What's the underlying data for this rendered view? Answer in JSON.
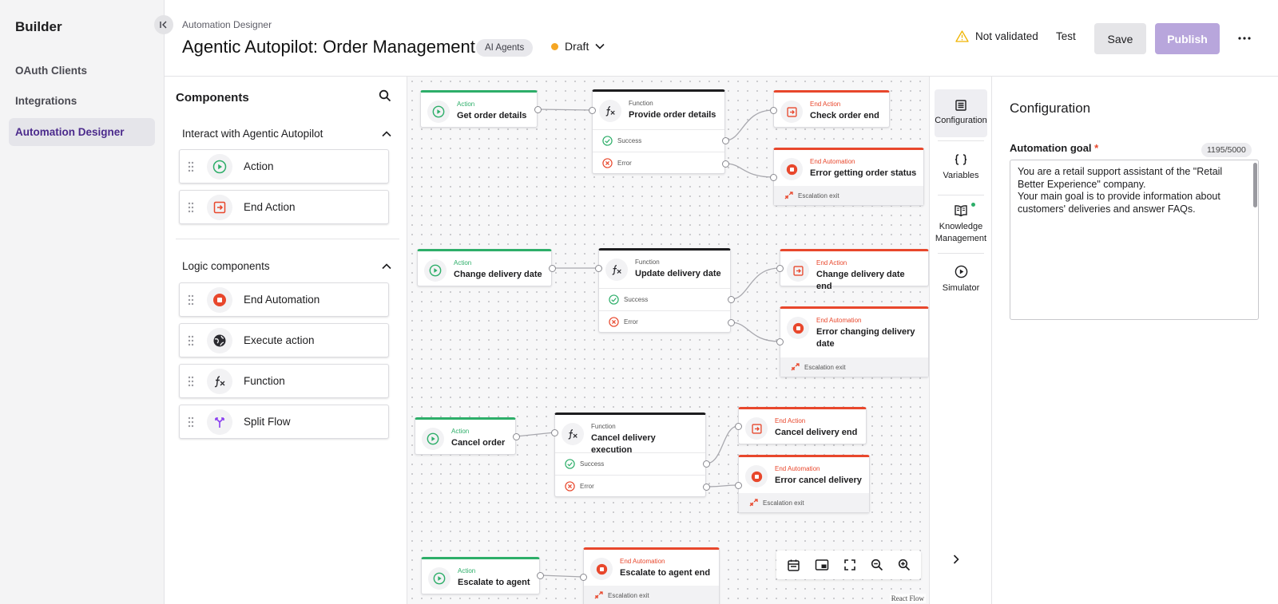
{
  "sidebar": {
    "brand": "Builder",
    "items": [
      {
        "label": "OAuth Clients"
      },
      {
        "label": "Integrations"
      },
      {
        "label": "Automation Designer"
      }
    ]
  },
  "header": {
    "breadcrumb": "Automation Designer",
    "title": "Agentic Autopilot: Order Management",
    "tag": "AI Agents",
    "status": "Draft",
    "validation": "Not validated",
    "test_label": "Test",
    "save_label": "Save",
    "publish_label": "Publish"
  },
  "components": {
    "title": "Components",
    "sections": [
      {
        "title": "Interact with Agentic Autopilot",
        "items": [
          {
            "label": "Action"
          },
          {
            "label": "End Action"
          }
        ]
      },
      {
        "title": "Logic components",
        "items": [
          {
            "label": "End Automation"
          },
          {
            "label": "Execute action"
          },
          {
            "label": "Function"
          },
          {
            "label": "Split Flow"
          }
        ]
      }
    ]
  },
  "canvas": {
    "nodes": {
      "get_order_details": {
        "type": "Action",
        "title": "Get order details"
      },
      "provide_order_details": {
        "type": "Function",
        "title": "Provide order details",
        "success": "Success",
        "error": "Error"
      },
      "check_order_end": {
        "type": "End Action",
        "title": "Check order end"
      },
      "error_getting_order_status": {
        "type": "End Automation",
        "title": "Error getting order status",
        "exit": "Escalation exit"
      },
      "change_delivery_date": {
        "type": "Action",
        "title": "Change delivery date"
      },
      "update_delivery_date": {
        "type": "Function",
        "title": "Update delivery date",
        "success": "Success",
        "error": "Error"
      },
      "change_delivery_date_end": {
        "type": "End Action",
        "title": "Change delivery date end"
      },
      "error_changing_delivery_date": {
        "type": "End Automation",
        "title": "Error changing delivery date",
        "exit": "Escalation exit"
      },
      "cancel_order": {
        "type": "Action",
        "title": "Cancel order"
      },
      "cancel_delivery_execution": {
        "type": "Function",
        "title": "Cancel delivery execution",
        "success": "Success",
        "error": "Error"
      },
      "cancel_delivery_end": {
        "type": "End Action",
        "title": "Cancel delivery end"
      },
      "error_cancel_delivery": {
        "type": "End Automation",
        "title": "Error cancel delivery",
        "exit": "Escalation exit"
      },
      "escalate_to_agent": {
        "type": "Action",
        "title": "Escalate to agent"
      },
      "escalate_to_agent_end": {
        "type": "End Automation",
        "title": "Escalate to agent end",
        "exit": "Escalation exit"
      }
    },
    "attribution": "React Flow"
  },
  "rail": {
    "items": [
      {
        "label": "Configuration"
      },
      {
        "label": "Variables"
      },
      {
        "label": "Knowledge Management"
      },
      {
        "label": "Simulator"
      }
    ]
  },
  "config": {
    "title": "Configuration",
    "goal_label": "Automation goal",
    "goal_required": "*",
    "goal_count": "1195/5000",
    "goal_text": "You are a retail support assistant of the \"Retail Better Experience\" company.\nYour main goal is to provide information about customers' deliveries and answer FAQs."
  },
  "colors": {
    "accent": "#4b2a8c",
    "publish": "#b8a6dc",
    "action": "#2dae69",
    "end": "#e8472c",
    "draft": "#f5a623"
  }
}
